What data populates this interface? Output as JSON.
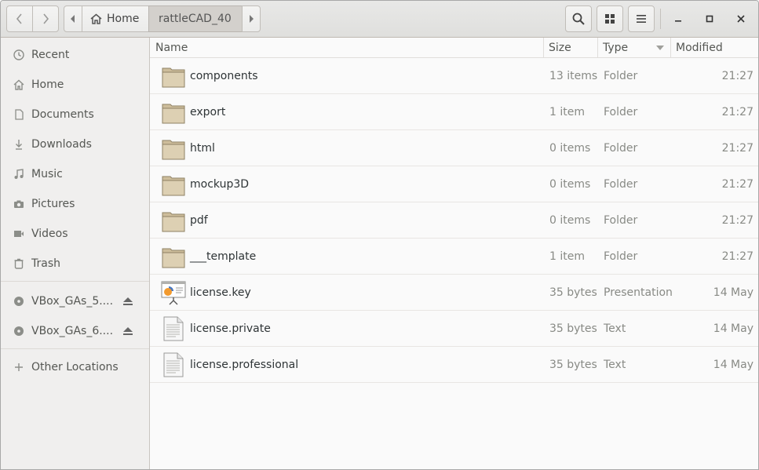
{
  "window": {
    "path": {
      "home_label": "Home",
      "current_folder": "rattleCAD_40"
    }
  },
  "sidebar": {
    "places": [
      {
        "label": "Recent",
        "icon": "clock-icon"
      },
      {
        "label": "Home",
        "icon": "home-icon"
      },
      {
        "label": "Documents",
        "icon": "document-icon"
      },
      {
        "label": "Downloads",
        "icon": "download-icon"
      },
      {
        "label": "Music",
        "icon": "music-icon"
      },
      {
        "label": "Pictures",
        "icon": "camera-icon"
      },
      {
        "label": "Videos",
        "icon": "video-icon"
      },
      {
        "label": "Trash",
        "icon": "trash-icon"
      }
    ],
    "devices": [
      {
        "label": "VBox_GAs_5....",
        "icon": "disc-icon"
      },
      {
        "label": "VBox_GAs_6....",
        "icon": "disc-icon"
      }
    ],
    "other": {
      "label": "Other Locations",
      "icon": "plus-icon"
    }
  },
  "columns": {
    "name": "Name",
    "size": "Size",
    "type": "Type",
    "modified": "Modified"
  },
  "files": [
    {
      "name": "components",
      "size": "13 items",
      "type": "Folder",
      "modified": "21:27",
      "kind": "folder"
    },
    {
      "name": "export",
      "size": "1 item",
      "type": "Folder",
      "modified": "21:27",
      "kind": "folder"
    },
    {
      "name": "html",
      "size": "0 items",
      "type": "Folder",
      "modified": "21:27",
      "kind": "folder"
    },
    {
      "name": "mockup3D",
      "size": "0 items",
      "type": "Folder",
      "modified": "21:27",
      "kind": "folder"
    },
    {
      "name": "pdf",
      "size": "0 items",
      "type": "Folder",
      "modified": "21:27",
      "kind": "folder"
    },
    {
      "name": "___template",
      "size": "1 item",
      "type": "Folder",
      "modified": "21:27",
      "kind": "folder"
    },
    {
      "name": "license.key",
      "size": "35 bytes",
      "type": "Presentation",
      "modified": "14 May",
      "kind": "presentation"
    },
    {
      "name": "license.private",
      "size": "35 bytes",
      "type": "Text",
      "modified": "14 May",
      "kind": "text"
    },
    {
      "name": "license.professional",
      "size": "35 bytes",
      "type": "Text",
      "modified": "14 May",
      "kind": "text"
    }
  ],
  "colors": {
    "folder_fill": "#d8c9a8",
    "folder_edge": "#8f8164",
    "sidebar_bg": "#f0efee",
    "header_bg": "#e3e3e1"
  }
}
